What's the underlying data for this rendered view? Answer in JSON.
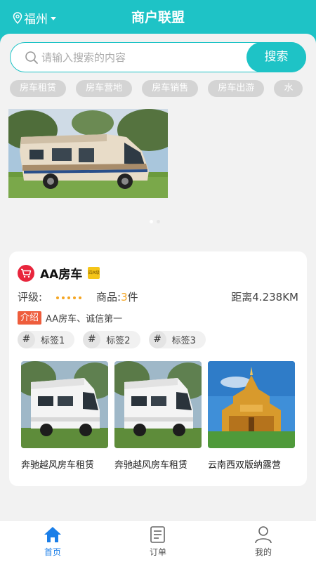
{
  "header": {
    "city": "福州",
    "title": "商户联盟"
  },
  "search": {
    "placeholder": "请输入搜索的内容",
    "button": "搜索"
  },
  "categories": [
    "房车租赁",
    "房车营地",
    "房车销售",
    "房车出游",
    "水"
  ],
  "banner": {
    "image": "rv-motorhome-photo"
  },
  "shop": {
    "name": "AA房车",
    "badge": "四A级",
    "rating_label": "评级:",
    "rating_dots": 5,
    "goods_prefix": "商品:",
    "goods_count": "3",
    "goods_suffix": "件",
    "distance": "距离4.238KM",
    "intro_label": "介绍",
    "intro_text": "AA房车、诚信第一",
    "labels": [
      "标签1",
      "标签2",
      "标签3"
    ],
    "products": [
      {
        "name": "奔驰越风房车租赁",
        "image": "white-rv-photo"
      },
      {
        "name": "奔驰越风房车租赁",
        "image": "white-rv-photo"
      },
      {
        "name": "云南西双版纳露营",
        "image": "golden-temple-photo"
      }
    ]
  },
  "tabbar": [
    {
      "label": "首页",
      "icon": "home-icon",
      "active": true
    },
    {
      "label": "订单",
      "icon": "order-icon",
      "active": false
    },
    {
      "label": "我的",
      "icon": "profile-icon",
      "active": false
    }
  ],
  "colors": {
    "accent": "#1ec3c6",
    "active_tab": "#1a7ee8",
    "rating": "#f5a623",
    "intro": "#ee5d3c"
  }
}
